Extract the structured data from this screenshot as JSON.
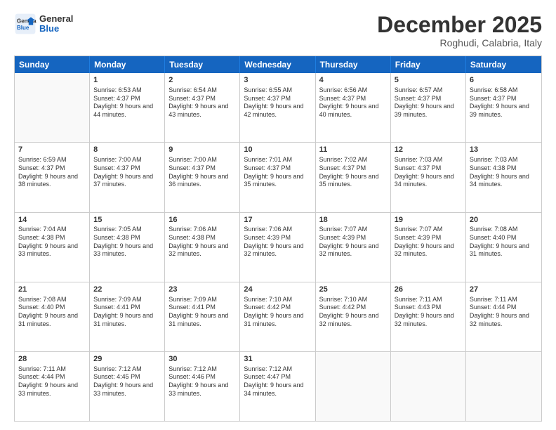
{
  "header": {
    "logo_general": "General",
    "logo_blue": "Blue",
    "month_title": "December 2025",
    "location": "Roghudi, Calabria, Italy"
  },
  "weekdays": [
    "Sunday",
    "Monday",
    "Tuesday",
    "Wednesday",
    "Thursday",
    "Friday",
    "Saturday"
  ],
  "rows": [
    [
      {
        "day": "",
        "empty": true
      },
      {
        "day": "1",
        "sunrise": "Sunrise: 6:53 AM",
        "sunset": "Sunset: 4:37 PM",
        "daylight": "Daylight: 9 hours and 44 minutes."
      },
      {
        "day": "2",
        "sunrise": "Sunrise: 6:54 AM",
        "sunset": "Sunset: 4:37 PM",
        "daylight": "Daylight: 9 hours and 43 minutes."
      },
      {
        "day": "3",
        "sunrise": "Sunrise: 6:55 AM",
        "sunset": "Sunset: 4:37 PM",
        "daylight": "Daylight: 9 hours and 42 minutes."
      },
      {
        "day": "4",
        "sunrise": "Sunrise: 6:56 AM",
        "sunset": "Sunset: 4:37 PM",
        "daylight": "Daylight: 9 hours and 40 minutes."
      },
      {
        "day": "5",
        "sunrise": "Sunrise: 6:57 AM",
        "sunset": "Sunset: 4:37 PM",
        "daylight": "Daylight: 9 hours and 39 minutes."
      },
      {
        "day": "6",
        "sunrise": "Sunrise: 6:58 AM",
        "sunset": "Sunset: 4:37 PM",
        "daylight": "Daylight: 9 hours and 39 minutes."
      }
    ],
    [
      {
        "day": "7",
        "sunrise": "Sunrise: 6:59 AM",
        "sunset": "Sunset: 4:37 PM",
        "daylight": "Daylight: 9 hours and 38 minutes."
      },
      {
        "day": "8",
        "sunrise": "Sunrise: 7:00 AM",
        "sunset": "Sunset: 4:37 PM",
        "daylight": "Daylight: 9 hours and 37 minutes."
      },
      {
        "day": "9",
        "sunrise": "Sunrise: 7:00 AM",
        "sunset": "Sunset: 4:37 PM",
        "daylight": "Daylight: 9 hours and 36 minutes."
      },
      {
        "day": "10",
        "sunrise": "Sunrise: 7:01 AM",
        "sunset": "Sunset: 4:37 PM",
        "daylight": "Daylight: 9 hours and 35 minutes."
      },
      {
        "day": "11",
        "sunrise": "Sunrise: 7:02 AM",
        "sunset": "Sunset: 4:37 PM",
        "daylight": "Daylight: 9 hours and 35 minutes."
      },
      {
        "day": "12",
        "sunrise": "Sunrise: 7:03 AM",
        "sunset": "Sunset: 4:37 PM",
        "daylight": "Daylight: 9 hours and 34 minutes."
      },
      {
        "day": "13",
        "sunrise": "Sunrise: 7:03 AM",
        "sunset": "Sunset: 4:38 PM",
        "daylight": "Daylight: 9 hours and 34 minutes."
      }
    ],
    [
      {
        "day": "14",
        "sunrise": "Sunrise: 7:04 AM",
        "sunset": "Sunset: 4:38 PM",
        "daylight": "Daylight: 9 hours and 33 minutes."
      },
      {
        "day": "15",
        "sunrise": "Sunrise: 7:05 AM",
        "sunset": "Sunset: 4:38 PM",
        "daylight": "Daylight: 9 hours and 33 minutes."
      },
      {
        "day": "16",
        "sunrise": "Sunrise: 7:06 AM",
        "sunset": "Sunset: 4:38 PM",
        "daylight": "Daylight: 9 hours and 32 minutes."
      },
      {
        "day": "17",
        "sunrise": "Sunrise: 7:06 AM",
        "sunset": "Sunset: 4:39 PM",
        "daylight": "Daylight: 9 hours and 32 minutes."
      },
      {
        "day": "18",
        "sunrise": "Sunrise: 7:07 AM",
        "sunset": "Sunset: 4:39 PM",
        "daylight": "Daylight: 9 hours and 32 minutes."
      },
      {
        "day": "19",
        "sunrise": "Sunrise: 7:07 AM",
        "sunset": "Sunset: 4:39 PM",
        "daylight": "Daylight: 9 hours and 32 minutes."
      },
      {
        "day": "20",
        "sunrise": "Sunrise: 7:08 AM",
        "sunset": "Sunset: 4:40 PM",
        "daylight": "Daylight: 9 hours and 31 minutes."
      }
    ],
    [
      {
        "day": "21",
        "sunrise": "Sunrise: 7:08 AM",
        "sunset": "Sunset: 4:40 PM",
        "daylight": "Daylight: 9 hours and 31 minutes."
      },
      {
        "day": "22",
        "sunrise": "Sunrise: 7:09 AM",
        "sunset": "Sunset: 4:41 PM",
        "daylight": "Daylight: 9 hours and 31 minutes."
      },
      {
        "day": "23",
        "sunrise": "Sunrise: 7:09 AM",
        "sunset": "Sunset: 4:41 PM",
        "daylight": "Daylight: 9 hours and 31 minutes."
      },
      {
        "day": "24",
        "sunrise": "Sunrise: 7:10 AM",
        "sunset": "Sunset: 4:42 PM",
        "daylight": "Daylight: 9 hours and 31 minutes."
      },
      {
        "day": "25",
        "sunrise": "Sunrise: 7:10 AM",
        "sunset": "Sunset: 4:42 PM",
        "daylight": "Daylight: 9 hours and 32 minutes."
      },
      {
        "day": "26",
        "sunrise": "Sunrise: 7:11 AM",
        "sunset": "Sunset: 4:43 PM",
        "daylight": "Daylight: 9 hours and 32 minutes."
      },
      {
        "day": "27",
        "sunrise": "Sunrise: 7:11 AM",
        "sunset": "Sunset: 4:44 PM",
        "daylight": "Daylight: 9 hours and 32 minutes."
      }
    ],
    [
      {
        "day": "28",
        "sunrise": "Sunrise: 7:11 AM",
        "sunset": "Sunset: 4:44 PM",
        "daylight": "Daylight: 9 hours and 33 minutes."
      },
      {
        "day": "29",
        "sunrise": "Sunrise: 7:12 AM",
        "sunset": "Sunset: 4:45 PM",
        "daylight": "Daylight: 9 hours and 33 minutes."
      },
      {
        "day": "30",
        "sunrise": "Sunrise: 7:12 AM",
        "sunset": "Sunset: 4:46 PM",
        "daylight": "Daylight: 9 hours and 33 minutes."
      },
      {
        "day": "31",
        "sunrise": "Sunrise: 7:12 AM",
        "sunset": "Sunset: 4:47 PM",
        "daylight": "Daylight: 9 hours and 34 minutes."
      },
      {
        "day": "",
        "empty": true
      },
      {
        "day": "",
        "empty": true
      },
      {
        "day": "",
        "empty": true
      }
    ]
  ]
}
